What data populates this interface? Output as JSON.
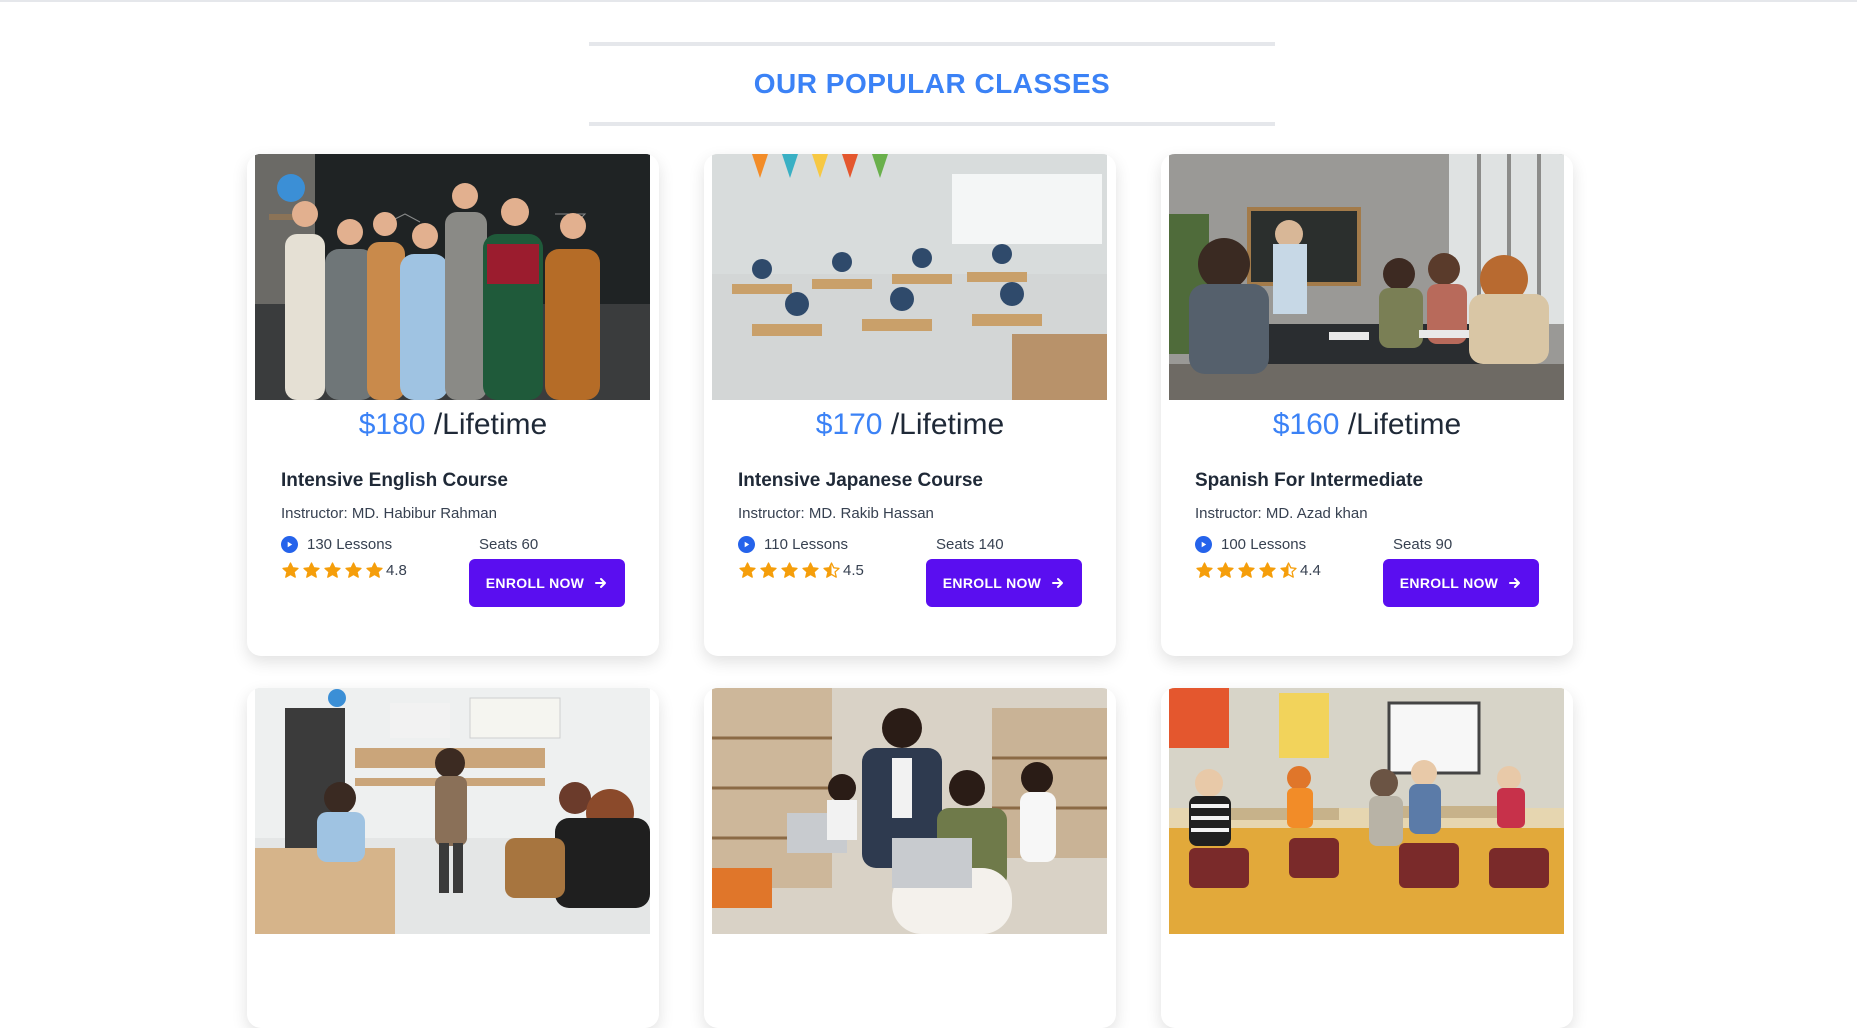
{
  "section": {
    "title": "OUR POPULAR CLASSES"
  },
  "colors": {
    "accent": "#3b82f6",
    "button": "#5a0ef0",
    "star": "#f59e0b"
  },
  "classes": [
    {
      "price": "$180",
      "period": "/Lifetime",
      "title": "Intensive English Course",
      "instructor": "Instructor: MD. Habibur Rahman",
      "lessons": "130 Lessons",
      "seats": "Seats 60",
      "rating_value": 4.8,
      "rating": "4.8",
      "button": "ENROLL NOW",
      "image": "classroom-group-photo"
    },
    {
      "price": "$170",
      "period": "/Lifetime",
      "title": "Intensive Japanese Course",
      "instructor": "Instructor: MD. Rakib Hassan",
      "lessons": "110 Lessons",
      "seats": "Seats 140",
      "rating_value": 4.5,
      "rating": "4.5",
      "button": "ENROLL NOW",
      "image": "classroom-desks-photo"
    },
    {
      "price": "$160",
      "period": "/Lifetime",
      "title": "Spanish For Intermediate",
      "instructor": "Instructor: MD. Azad khan",
      "lessons": "100 Lessons",
      "seats": "Seats 90",
      "rating_value": 4.4,
      "rating": "4.4",
      "button": "ENROLL NOW",
      "image": "study-table-photo"
    },
    {
      "image": "teacher-classroom-photo"
    },
    {
      "image": "laptop-tutoring-photo"
    },
    {
      "image": "primary-classroom-photo"
    }
  ]
}
